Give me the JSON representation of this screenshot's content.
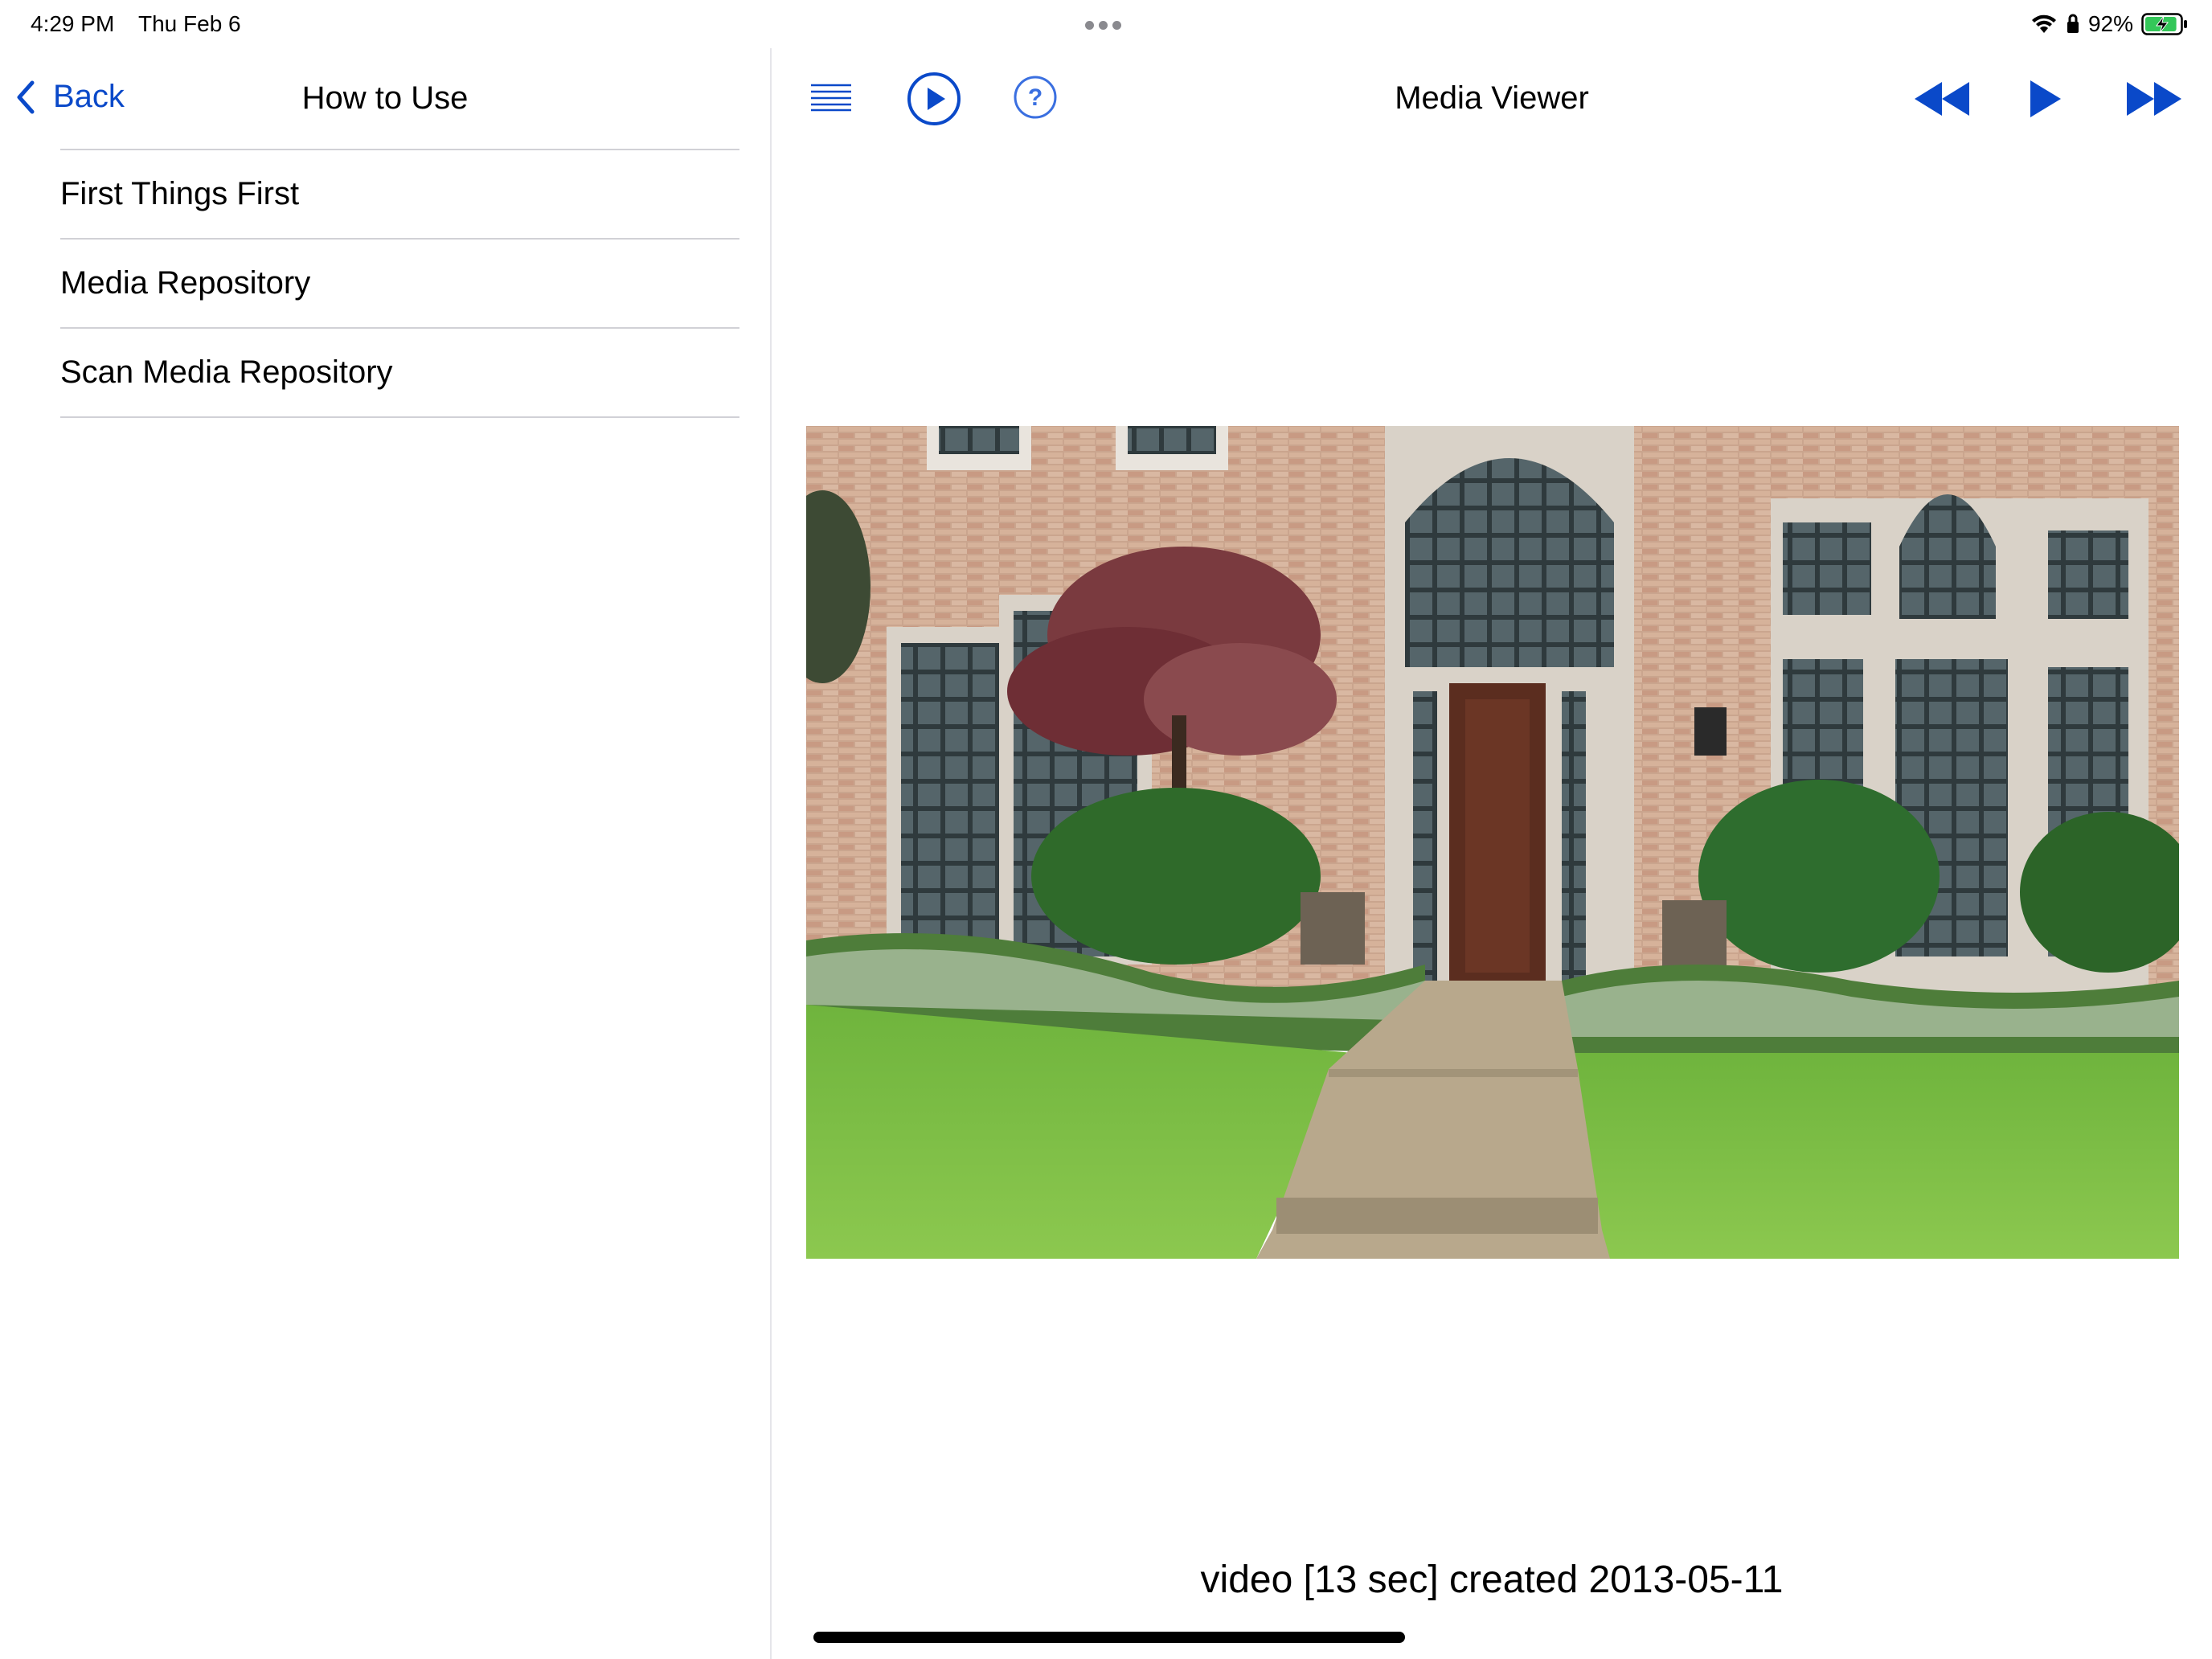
{
  "status_bar": {
    "time": "4:29 PM",
    "date": "Thu Feb 6",
    "battery_percent": "92%",
    "battery_level": 0.92
  },
  "sidebar": {
    "back_label": "Back",
    "title": "How to Use",
    "items": [
      {
        "label": "First Things First"
      },
      {
        "label": "Media Repository"
      },
      {
        "label": "Scan Media Repository"
      }
    ]
  },
  "main": {
    "title": "Media Viewer",
    "toolbar_icons": [
      "list-icon",
      "play-circle-icon",
      "help-circle-icon",
      "rewind-icon",
      "play-icon",
      "fast-forward-icon"
    ],
    "caption": "video [13 sec] created 2013-05-11"
  },
  "colors": {
    "accent": "#0a49c9",
    "battery_fill": "#34c759",
    "separator": "#d1d1d6"
  }
}
